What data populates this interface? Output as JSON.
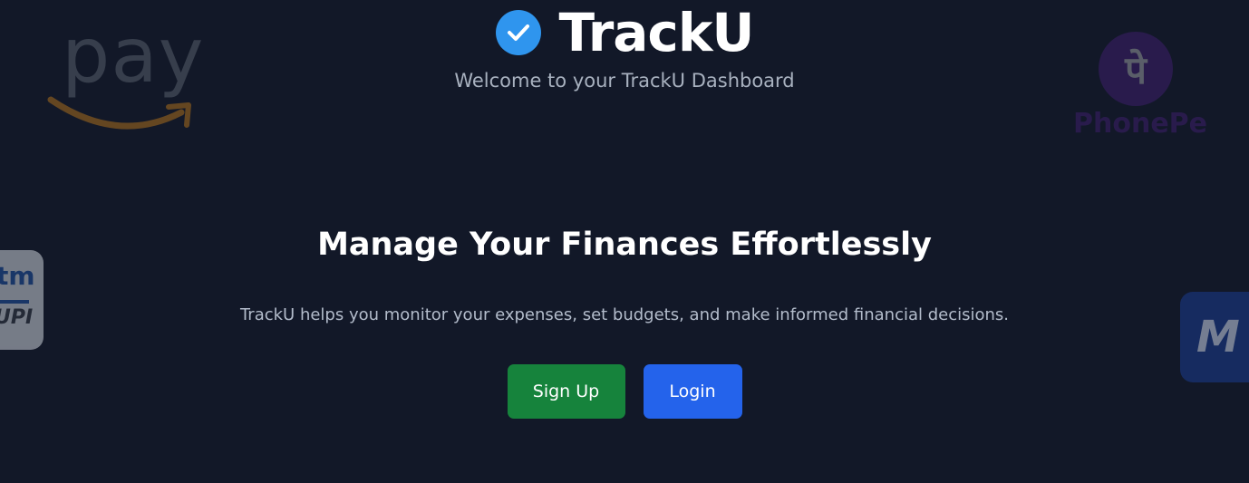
{
  "header": {
    "brand_icon": "check-circle-icon",
    "title": "TrackU",
    "subtitle": "Welcome to your TrackU Dashboard"
  },
  "hero": {
    "headline": "Manage Your Finances Effortlessly",
    "description": "TrackU helps you monitor your expenses, set budgets, and make informed financial decisions."
  },
  "actions": {
    "signup_label": "Sign Up",
    "login_label": "Login"
  },
  "decorative_logos": {
    "amazon_pay": "pay",
    "phonepe": "PhonePe",
    "paytm": "tm",
    "paytm_upi": "UPI",
    "mobikwik": "M"
  },
  "colors": {
    "background": "#121828",
    "brand_check": "#2f95ee",
    "signup_button": "#16833c",
    "login_button": "#2463eb"
  }
}
